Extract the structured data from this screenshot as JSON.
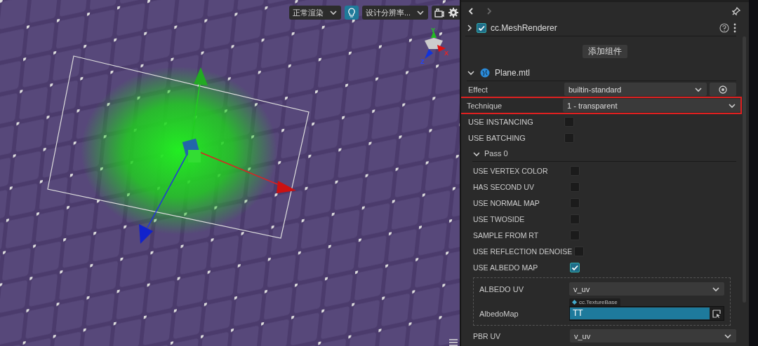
{
  "scene": {
    "toolbar": {
      "render_mode": "正常渲染",
      "light_on": true,
      "resolution": "设计分辨率..."
    },
    "gizmo_axes": [
      "Y",
      "X",
      "Z"
    ]
  },
  "inspector": {
    "component": {
      "name": "cc.MeshRenderer",
      "checked": true,
      "expanded": false
    },
    "add_button": "添加组件",
    "material": {
      "name": "Plane.mtl",
      "expanded": true
    },
    "rows": [
      {
        "kind": "select",
        "label": "Effect",
        "value": "builtin-standard",
        "highlighted": false,
        "locate": true
      },
      {
        "kind": "select",
        "label": "Technique",
        "value": "1 - transparent",
        "highlighted": true,
        "locate": false
      },
      {
        "kind": "checkbox",
        "label": "USE INSTANCING",
        "checked": false
      },
      {
        "kind": "checkbox",
        "label": "USE BATCHING",
        "checked": false
      }
    ],
    "pass": {
      "title": "Pass 0",
      "expanded": true,
      "rows": [
        {
          "kind": "checkbox",
          "label": "USE VERTEX COLOR",
          "checked": false
        },
        {
          "kind": "checkbox",
          "label": "HAS SECOND UV",
          "checked": false
        },
        {
          "kind": "checkbox",
          "label": "USE NORMAL MAP",
          "checked": false
        },
        {
          "kind": "checkbox",
          "label": "USE TWOSIDE",
          "checked": false
        },
        {
          "kind": "checkbox",
          "label": "SAMPLE FROM RT",
          "checked": false
        },
        {
          "kind": "checkbox",
          "label": "USE REFLECTION DENOISE",
          "checked": false
        },
        {
          "kind": "checkbox",
          "label": "USE ALBEDO MAP",
          "checked": true
        },
        {
          "kind": "group",
          "children": [
            {
              "kind": "select",
              "label": "ALBEDO UV",
              "value": "v_uv",
              "highlighted": false,
              "locate": false
            },
            {
              "kind": "texture",
              "label": "AlbedoMap",
              "type": "cc.TextureBase",
              "value": "TT"
            }
          ]
        },
        {
          "kind": "select",
          "label": "PBR UV",
          "value": "v_uv",
          "highlighted": false,
          "locate": false
        }
      ]
    }
  }
}
